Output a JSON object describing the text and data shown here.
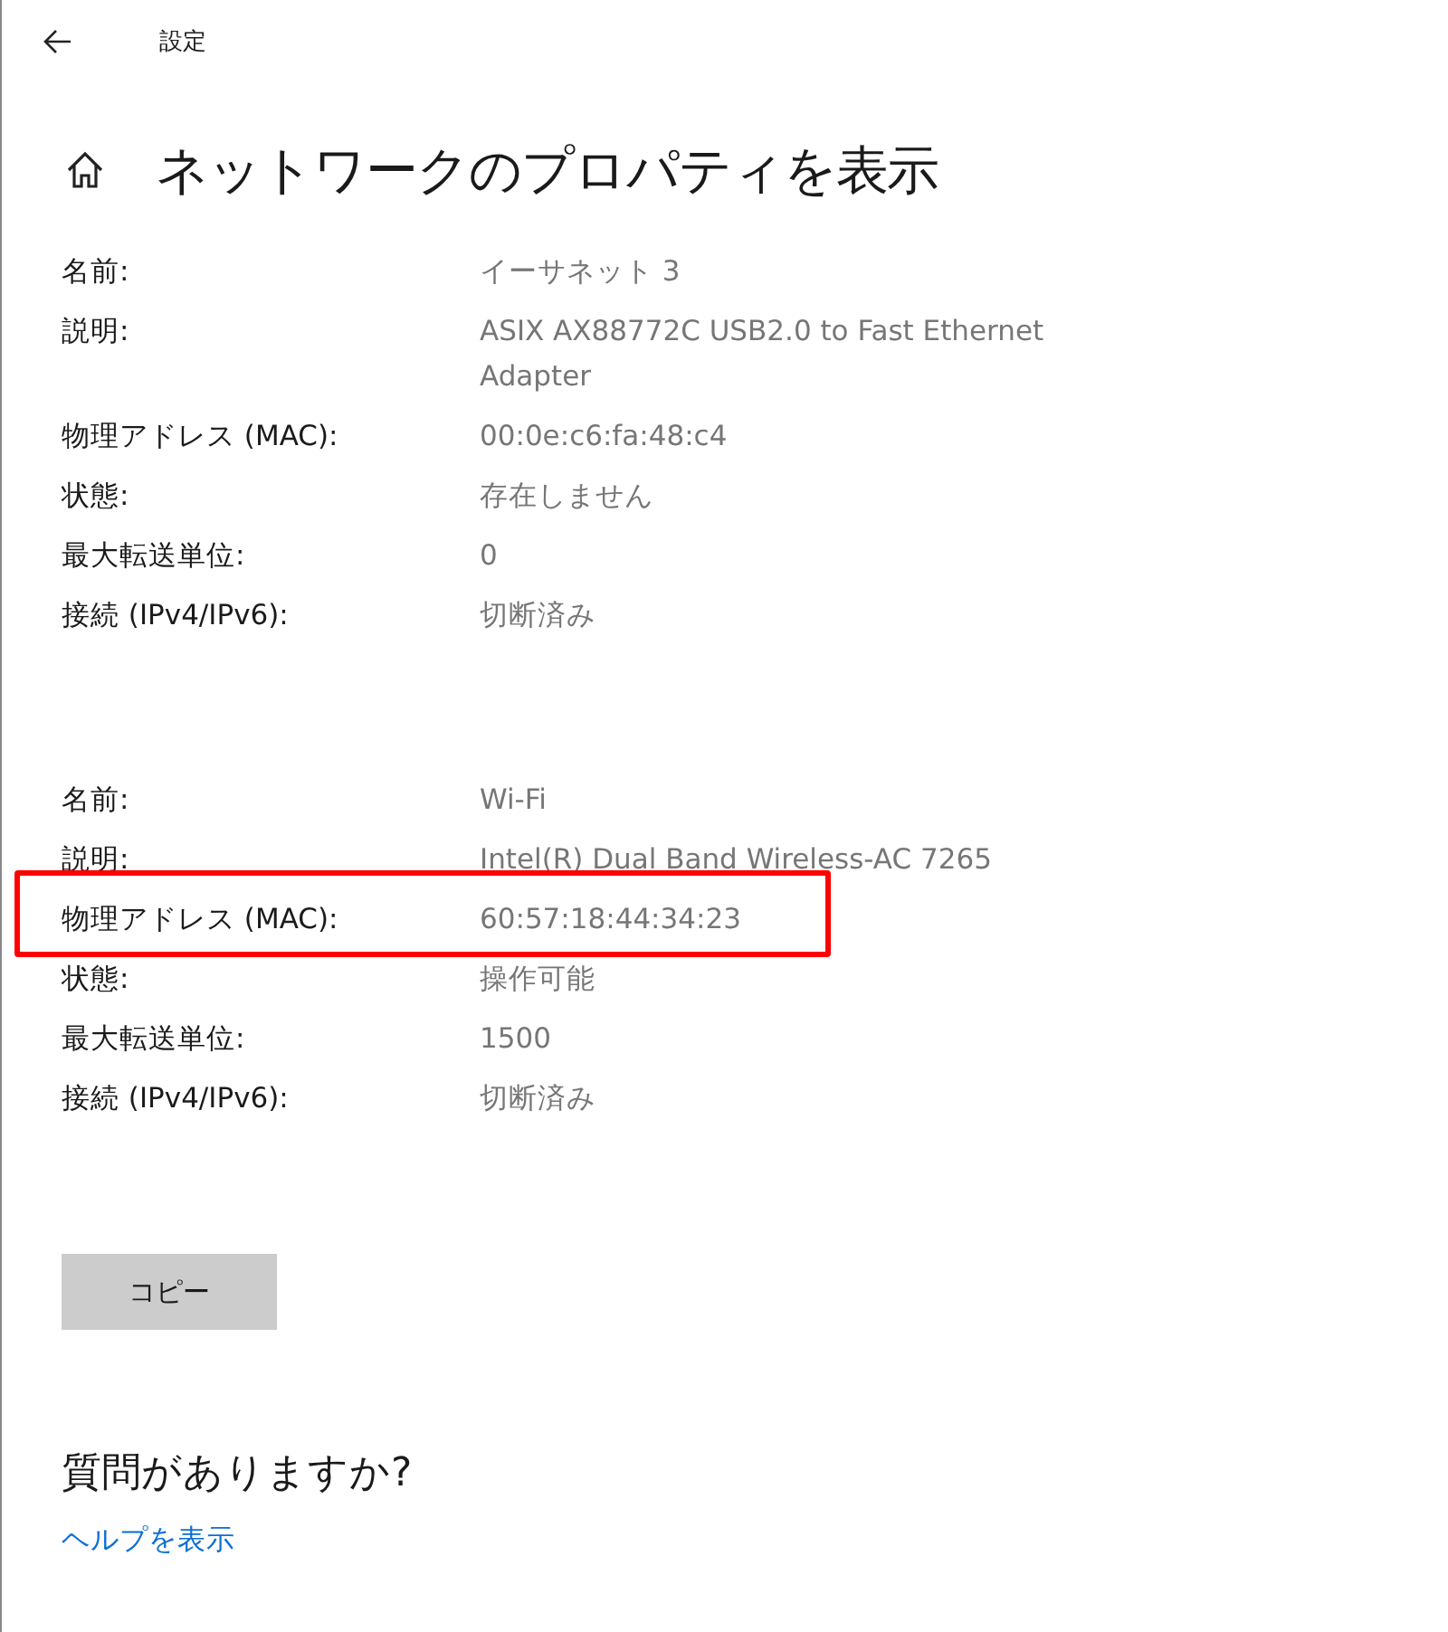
{
  "window": {
    "title": "設定"
  },
  "page": {
    "title": "ネットワークのプロパティを表示"
  },
  "adapters": [
    {
      "properties": [
        {
          "label": "名前:",
          "value": "イーサネット 3",
          "highlighted": false
        },
        {
          "label": "説明:",
          "value": "ASIX AX88772C USB2.0 to Fast Ethernet Adapter",
          "highlighted": false
        },
        {
          "label": "物理アドレス (MAC):",
          "value": "00:0e:c6:fa:48:c4",
          "highlighted": false
        },
        {
          "label": "状態:",
          "value": "存在しません",
          "highlighted": false
        },
        {
          "label": "最大転送単位:",
          "value": "0",
          "highlighted": false
        },
        {
          "label": "接続 (IPv4/IPv6):",
          "value": "切断済み",
          "highlighted": false
        }
      ]
    },
    {
      "properties": [
        {
          "label": "名前:",
          "value": "Wi-Fi",
          "highlighted": false
        },
        {
          "label": "説明:",
          "value": "Intel(R) Dual Band Wireless-AC 7265",
          "highlighted": false
        },
        {
          "label": "物理アドレス (MAC):",
          "value": "60:57:18:44:34:23",
          "highlighted": true
        },
        {
          "label": "状態:",
          "value": "操作可能",
          "highlighted": false
        },
        {
          "label": "最大転送単位:",
          "value": "1500",
          "highlighted": false
        },
        {
          "label": "接続 (IPv4/IPv6):",
          "value": "切断済み",
          "highlighted": false
        }
      ]
    }
  ],
  "copy_button": {
    "label": "コピー"
  },
  "help": {
    "title": "質問がありますか?",
    "link": "ヘルプを表示"
  }
}
